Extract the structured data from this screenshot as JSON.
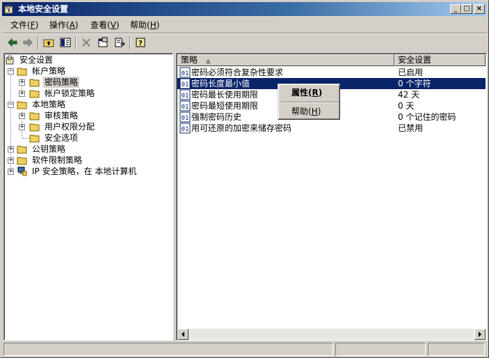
{
  "window": {
    "title": "本地安全设置",
    "min_label": "_",
    "max_label": "□",
    "close_label": "×"
  },
  "menu": [
    {
      "label": "文件(",
      "key": "F",
      "end": ")"
    },
    {
      "label": "操作(",
      "key": "A",
      "end": ")"
    },
    {
      "label": "查看(",
      "key": "V",
      "end": ")"
    },
    {
      "label": "帮助(",
      "key": "H",
      "end": ")"
    }
  ],
  "tree": {
    "root": "安全设置",
    "account_policies": "帐户策略",
    "password_policy": "密码策略",
    "account_lockout_policy": "帐户锁定策略",
    "local_policies": "本地策略",
    "audit_policy": "审核策略",
    "user_rights": "用户权限分配",
    "security_options": "安全选项",
    "public_key_policies": "公钥策略",
    "software_restriction": "软件限制策略",
    "ip_security": "IP 安全策略，在 本地计算机"
  },
  "columns": {
    "policy": "策略",
    "setting": "安全设置"
  },
  "rows": [
    {
      "policy": "密码必须符合复杂性要求",
      "setting": "已启用"
    },
    {
      "policy": "密码长度最小值",
      "setting": "0 个字符"
    },
    {
      "policy": "密码最长使用期限",
      "setting": "42 天"
    },
    {
      "policy": "密码最短使用期限",
      "setting": "0 天"
    },
    {
      "policy": "强制密码历史",
      "setting": "0 个记住的密码"
    },
    {
      "policy": "用可还原的加密来储存密码",
      "setting": "已禁用"
    }
  ],
  "context_menu": {
    "properties": "属性(",
    "properties_key": "R",
    "help": "帮助(",
    "help_key": "H",
    "close_paren": ")"
  },
  "icons": {
    "title": "security-settings-icon",
    "back": "back-arrow-icon",
    "forward": "forward-arrow-icon",
    "up": "up-folder-icon",
    "show_tree": "show-tree-icon",
    "delete": "delete-icon",
    "properties": "properties-icon",
    "export": "export-list-icon",
    "help": "help-icon"
  },
  "colors": {
    "title_start": "#0a246a",
    "title_end": "#a6caf0",
    "selection": "#0a246a",
    "face": "#d4d0c8"
  }
}
